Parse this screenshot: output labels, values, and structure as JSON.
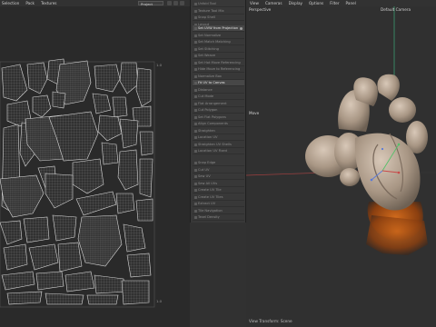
{
  "uv_menubar": {
    "items": [
      "Selection",
      "Pack",
      "Textures"
    ],
    "project_label": "Project"
  },
  "viewport_menubar": {
    "items": [
      "View",
      "Cameras",
      "Display",
      "Options",
      "Filter",
      "Panel"
    ]
  },
  "viewport": {
    "perspective_label": "Perspective",
    "camera_label": "Default Camera",
    "move_label": "Move",
    "footer_label": "View Transform: Scene"
  },
  "uv_axis": {
    "top_right": "1.0",
    "bottom_right": "1.0"
  },
  "tools": {
    "items": [
      "Unfold Tool",
      "Texture Tool Mix",
      "Snap Shell",
      "Layout",
      "Set UVW from Projection",
      "Set Normalize",
      "Set Match Matching",
      "Set Stitching",
      "Set Weave",
      "Set Hot Move Referencing",
      "Hide Move to Referencing",
      "Normalize Box",
      "Fit UV to Canvas",
      "Distance",
      "Cut Mode",
      "Flat Arrangement",
      "Cut Polygon",
      "Set Flat Polygons",
      "Align Components",
      "Straighten",
      "Location UV",
      "Straighten UV Shells",
      "Location UV Fixed",
      "Snap Edge",
      "Cut UV",
      "Sew UV",
      "Sew All UVs",
      "Create UV Tile",
      "Create UV Tiles",
      "Extract UV",
      "Tile Navigation",
      "Texel Density",
      "Grouping"
    ]
  },
  "colors": {
    "accent": "#6b7fb0",
    "model": "#bdaa97",
    "orange": "#c2661e",
    "axis_red": "#c84a4a",
    "axis_green": "#56c06a",
    "axis_blue": "#5a7ad8"
  }
}
